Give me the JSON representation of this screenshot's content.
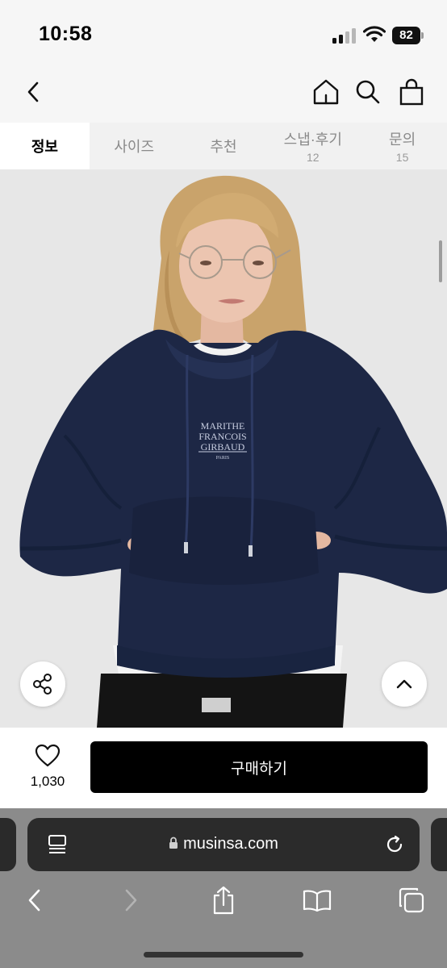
{
  "status_bar": {
    "time": "10:58",
    "battery": "82"
  },
  "nav": {
    "back_icon": "chevron-left-icon",
    "home_icon": "home-icon",
    "search_icon": "search-icon",
    "bag_icon": "shopping-bag-icon"
  },
  "tabs": [
    {
      "label": "정보",
      "count": ""
    },
    {
      "label": "사이즈",
      "count": ""
    },
    {
      "label": "추천",
      "count": ""
    },
    {
      "label": "스냅·후기",
      "count": "12"
    },
    {
      "label": "문의",
      "count": "15"
    }
  ],
  "product": {
    "logo_lines": [
      "MARITHE",
      "FRANCOIS",
      "GIRBAUD"
    ],
    "logo_sub": "PARIS",
    "colors": {
      "hoodie": "#1d2745",
      "background": "#e7e7e7"
    }
  },
  "purchase": {
    "like_count": "1,030",
    "buy_label": "구매하기"
  },
  "browser": {
    "url": "musinsa.com"
  },
  "colors": {
    "buy_button": "#000000",
    "browser_bar": "#8b8b8b",
    "address_bar": "#2b2b2b"
  }
}
